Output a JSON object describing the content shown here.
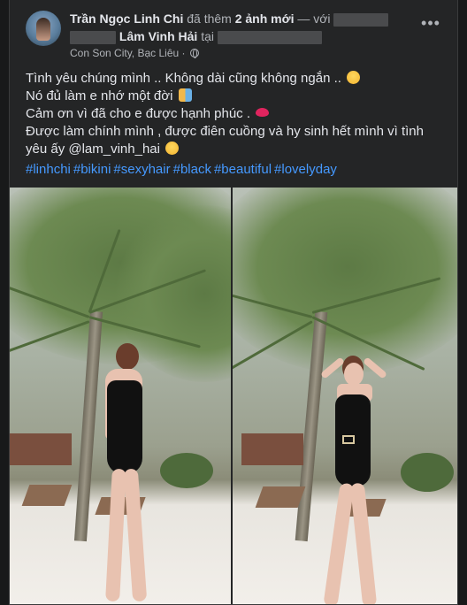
{
  "post": {
    "author": "Trần Ngọc Linh Chi",
    "action_text": "đã thêm",
    "photo_count": "2 ảnh mới",
    "with_text": "— với",
    "tagged_user": "Lâm Vinh Hải",
    "at_text": "tại",
    "location": "Con Son City, Bạc Liêu ·",
    "more_label": "•••"
  },
  "caption": {
    "line1": "Tình yêu chúng mình .. Không dài cũng không ngắn ..",
    "line2": "Nó đủ làm e nhớ một đời",
    "line3": "Cảm ơn vì đã cho e được hạnh phúc .",
    "line4": "Được làm chính mình , được điên cuồng và hy sinh hết mình vì tình",
    "line5": "yêu ấy @lam_vinh_hai"
  },
  "hashtags": [
    "#linhchi",
    "#bikini",
    "#sexyhair",
    "#black",
    "#beautiful",
    "#lovelyday"
  ],
  "icons": {
    "avatar": "profile-photo",
    "globe": "globe-icon",
    "more": "more-options-icon",
    "emoji1": "smiling-face-emoji",
    "emoji2": "couple-emoji",
    "emoji3": "kiss-mark-emoji",
    "emoji4": "smiling-face-emoji"
  },
  "colors": {
    "background": "#18191a",
    "card": "#242526",
    "text": "#e4e6eb",
    "muted": "#b0b3b8",
    "link": "#4599ff"
  }
}
